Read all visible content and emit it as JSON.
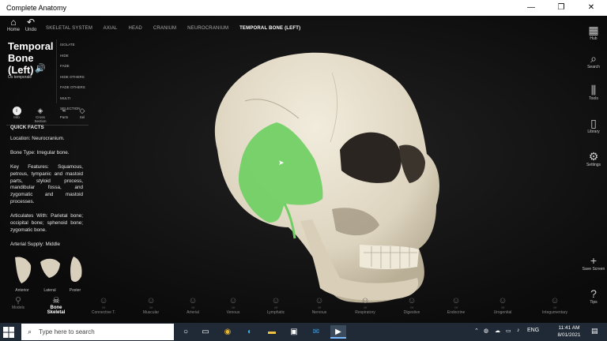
{
  "window": {
    "title": "Complete Anatomy",
    "minimize": "—",
    "maximize": "❐",
    "close": "✕"
  },
  "toolbar": {
    "home": "Home",
    "undo": "Undo"
  },
  "breadcrumb": [
    "SKELETAL SYSTEM",
    "AXIAL",
    "HEAD",
    "CRANIUM",
    "NEUROCRANIUM",
    "TEMPORAL BONE (LEFT)"
  ],
  "panel": {
    "title_lines": [
      "Temporal",
      "Bone",
      "(Left)"
    ],
    "latin": "Os temporale",
    "actions": [
      "ISOLATE",
      "HIDE",
      "FADE",
      "HIDE OTHERS",
      "FADE OTHERS",
      "MULTI SELECTION"
    ],
    "tabs": [
      {
        "label": "Info",
        "icon": "i"
      },
      {
        "label": "Cross Section",
        "icon": "◈"
      },
      {
        "label": "Parts",
        "icon": "⌁"
      },
      {
        "label": "Sel",
        "icon": "◇"
      }
    ],
    "facts_heading": "QUICK FACTS",
    "facts": [
      "Location: Neurocranium.",
      "Bone Type: Irregular bone.",
      "Key Features: Squamous, petrous, tympanic and mastoid parts, styloid process, mandibular fossa, and zygomatic and mastoid processes.",
      "Articulates With: Parietal bone; occipital bone; sphenoid bone; zygomatic bone.",
      "Arterial Supply: Middle"
    ],
    "views": [
      "Anterior",
      "Lateral",
      "Poster"
    ]
  },
  "right_bar": [
    {
      "label": "Hub",
      "icon": "▦"
    },
    {
      "label": "Search",
      "icon": "⌕"
    },
    {
      "label": "Tools",
      "icon": "⫼"
    },
    {
      "label": "Library",
      "icon": "▯"
    },
    {
      "label": "Settings",
      "icon": "⚙"
    },
    {
      "label": "Save Screen",
      "icon": "+"
    },
    {
      "label": "Tips",
      "icon": "?"
    }
  ],
  "systems": [
    {
      "label": "Models",
      "state": ""
    },
    {
      "label": "Bone",
      "sub": "Skeletal",
      "state": "",
      "active": true
    },
    {
      "label": "Connective T.",
      "state": "Off"
    },
    {
      "label": "Muscular",
      "state": "Off"
    },
    {
      "label": "Arterial",
      "state": "Off"
    },
    {
      "label": "Venous",
      "state": "Off"
    },
    {
      "label": "Lymphatic",
      "state": "Off"
    },
    {
      "label": "Nervous",
      "state": "Off"
    },
    {
      "label": "Respiratory",
      "state": "Off"
    },
    {
      "label": "Digestive",
      "state": "Off"
    },
    {
      "label": "Endocrine",
      "state": "Off"
    },
    {
      "label": "Urogenital",
      "state": "Off"
    },
    {
      "label": "Integumentary",
      "state": "Off"
    }
  ],
  "taskbar": {
    "search_placeholder": "Type here to search",
    "language": "ENG",
    "time": "11:41 AM",
    "date": "8/01/2021"
  },
  "colors": {
    "highlight": "#6fcf63",
    "bone": "#e7e0cf",
    "taskbar": "#1f2a36"
  }
}
